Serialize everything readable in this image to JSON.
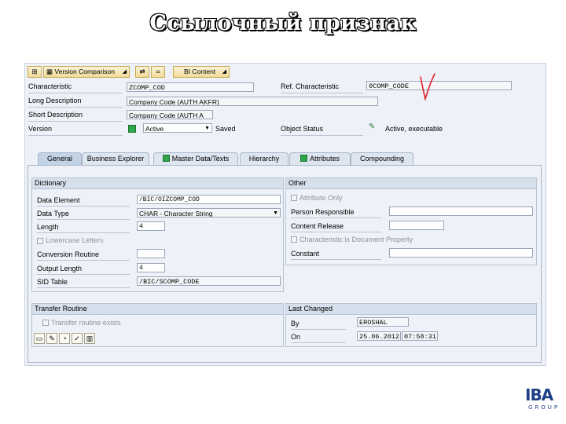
{
  "slide": {
    "title": "Ссылочный признак"
  },
  "toolbar": {
    "version_comparison": "Version Comparison",
    "bi_content": "BI Content"
  },
  "header": {
    "characteristic_label": "Characteristic",
    "characteristic_value": "ZCOMP_COD",
    "ref_characteristic_label": "Ref. Characteristic",
    "ref_characteristic_value": "0COMP_CODE",
    "long_description_label": "Long Description",
    "long_description_value": "Company Code (AUTH AKFR)",
    "short_description_label": "Short Description",
    "short_description_value": "Company Code (AUTH A",
    "version_label": "Version",
    "version_value": "Active",
    "version_saved": "Saved",
    "object_status_label": "Object Status",
    "object_status_value": "Active, executable"
  },
  "tabs": [
    {
      "label": "General"
    },
    {
      "label": "Business Explorer"
    },
    {
      "label": "Master Data/Texts"
    },
    {
      "label": "Hierarchy"
    },
    {
      "label": "Attributes"
    },
    {
      "label": "Compounding"
    }
  ],
  "dictionary": {
    "title": "Dictionary",
    "data_element_label": "Data Element",
    "data_element_value": "/BIC/OIZCOMP_COD",
    "data_type_label": "Data Type",
    "data_type_value": "CHAR - Character String",
    "length_label": "Length",
    "length_value": "4",
    "lowercase_label": "Lowercase Letters",
    "conversion_routine_label": "Conversion Routine",
    "output_length_label": "Output Length",
    "output_length_value": "4",
    "sid_table_label": "SID Table",
    "sid_table_value": "/BIC/SCOMP_CODE"
  },
  "other": {
    "title": "Other",
    "attribute_only_label": "Attribute Only",
    "person_responsible_label": "Person Responsible",
    "content_release_label": "Content Release",
    "characteristic_document_label": "Characteristic is Document Property",
    "constant_label": "Constant"
  },
  "transfer_routine": {
    "title": "Transfer Routine",
    "exists_label": "Transfer routine exists"
  },
  "last_changed": {
    "title": "Last Changed",
    "by_label": "By",
    "by_value": "EROSHAL",
    "on_label": "On",
    "on_date": "25.06.2012",
    "on_time": "07:58:31"
  },
  "colors": {
    "accent": "#1d3f86",
    "active_led": "#2ea64a",
    "annotation": "#e0202a"
  },
  "logo": {
    "text": "IBA",
    "subtext": "GROUP"
  }
}
